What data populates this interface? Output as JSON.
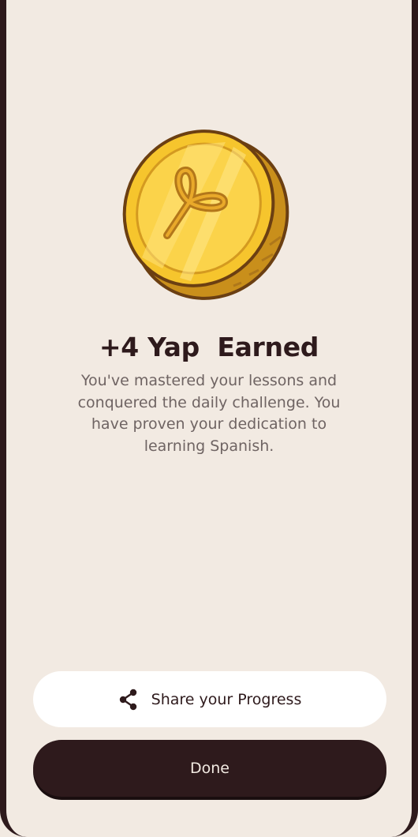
{
  "reward": {
    "title": "+4 Yap  Earned",
    "message": "You've mastered your lessons and conquered the daily challenge. You have proven your dedication to learning Spanish.",
    "coin_icon": "yap-coin-icon"
  },
  "actions": {
    "share_label": "Share your Progress",
    "share_icon": "share-icon",
    "done_label": "Done"
  },
  "colors": {
    "background": "#f2eae2",
    "primary_dark": "#2e1a1c",
    "coin_gold": "#f5c22e",
    "coin_edge": "#c98f1b",
    "text_muted": "#6f6463"
  }
}
